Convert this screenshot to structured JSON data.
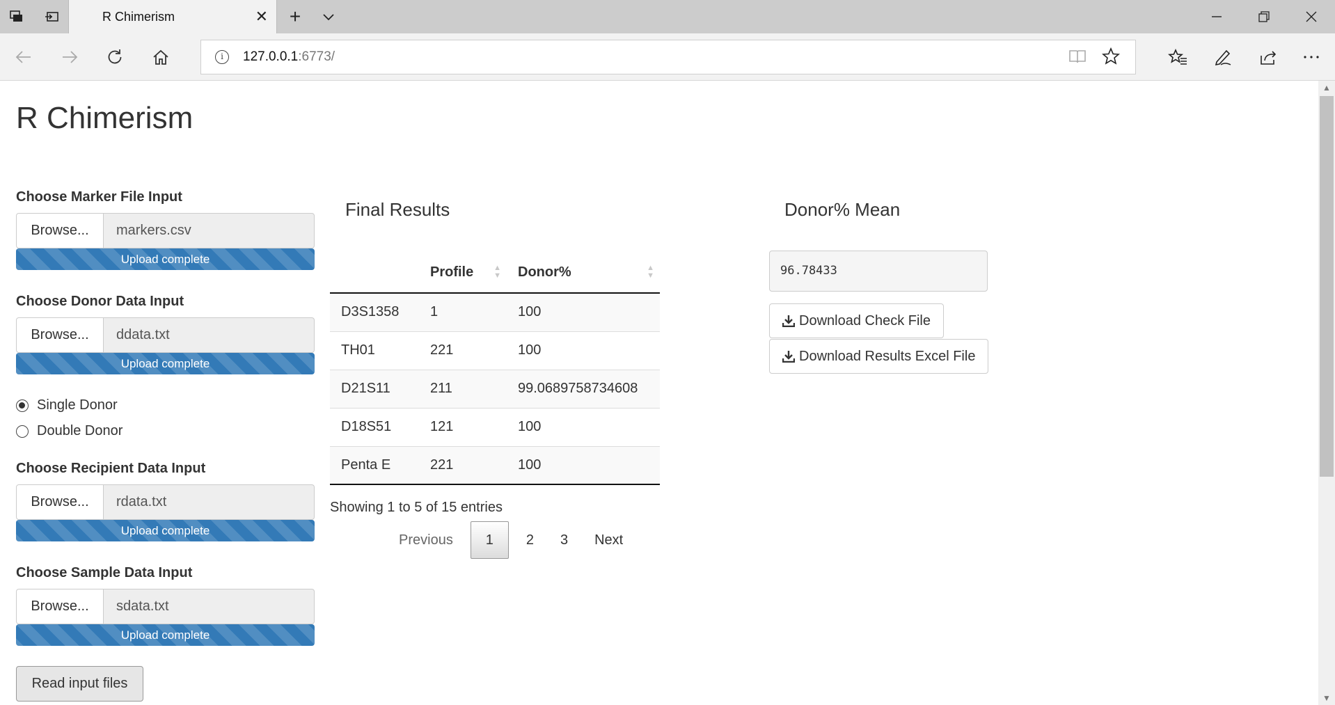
{
  "browser": {
    "tab_title": "R Chimerism",
    "url_host": "127.0.0.1",
    "url_port": ":6773/",
    "icons": [
      "tab-manager-icon",
      "set-aside-tabs-icon",
      "close-icon",
      "plus-icon",
      "chevron-down-icon",
      "minimize-icon",
      "restore-icon",
      "close-window-icon",
      "back-icon",
      "forward-icon",
      "refresh-icon",
      "home-icon",
      "info-icon",
      "reading-view-icon",
      "favorite-star-icon",
      "favorites-icon",
      "pen-icon",
      "share-icon",
      "more-icon"
    ]
  },
  "page": {
    "title": "R Chimerism"
  },
  "inputs": {
    "marker": {
      "label": "Choose Marker File Input",
      "browse": "Browse...",
      "file": "markers.csv",
      "status": "Upload complete",
      "progress": 1.0
    },
    "donor": {
      "label": "Choose Donor Data Input",
      "browse": "Browse...",
      "file": "ddata.txt",
      "status": "Upload complete",
      "progress": 1.0
    },
    "recipient": {
      "label": "Choose Recipient Data Input",
      "browse": "Browse...",
      "file": "rdata.txt",
      "status": "Upload complete",
      "progress": 1.0
    },
    "sample": {
      "label": "Choose Sample Data Input",
      "browse": "Browse...",
      "file": "sdata.txt",
      "status": "Upload complete",
      "progress": 1.0
    }
  },
  "donor_type": {
    "options": [
      "Single Donor",
      "Double Donor"
    ],
    "selected": "Single Donor"
  },
  "read_button": "Read input files",
  "results": {
    "title": "Final Results",
    "columns": [
      "",
      "Profile",
      "Donor%"
    ],
    "rows": [
      [
        "D3S1358",
        "1",
        "100"
      ],
      [
        "TH01",
        "221",
        "100"
      ],
      [
        "D21S11",
        "211",
        "99.0689758734608"
      ],
      [
        "D18S51",
        "121",
        "100"
      ],
      [
        "Penta E",
        "221",
        "100"
      ]
    ],
    "info": "Showing 1 to 5 of 15 entries",
    "pagination": {
      "previous": "Previous",
      "pages": [
        "1",
        "2",
        "3"
      ],
      "current": "1",
      "next": "Next"
    }
  },
  "mean": {
    "title": "Donor% Mean",
    "value": "96.78433",
    "download_check": "Download Check File",
    "download_results": "Download Results Excel File"
  },
  "colors": {
    "progress": "#337ab7",
    "tabbar": "#cccccc",
    "navbar": "#f2f2f2"
  }
}
